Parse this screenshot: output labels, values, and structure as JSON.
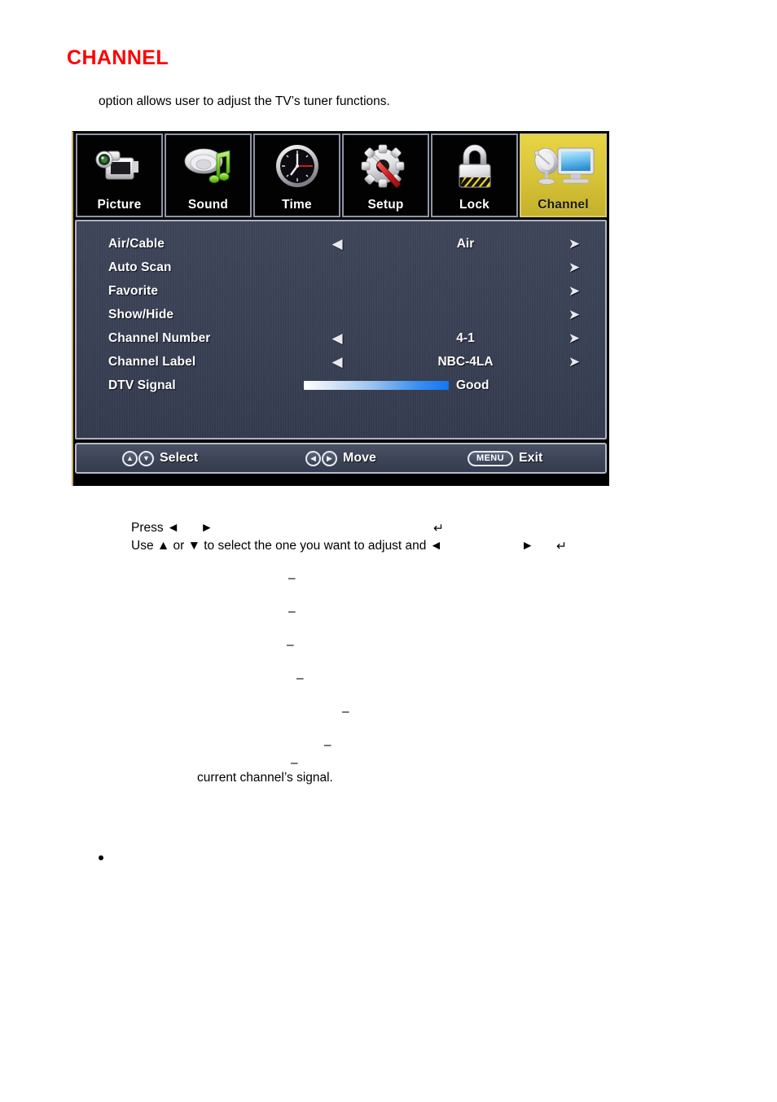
{
  "page": {
    "title": "CHANNEL",
    "title_color": "#fe0000",
    "intro": "option allows user to adjust the TV’s tuner functions."
  },
  "osd": {
    "tabs": [
      {
        "label": "Picture",
        "icon": "camcorder-icon",
        "active": false
      },
      {
        "label": "Sound",
        "icon": "speaker-music-note-icon",
        "active": false
      },
      {
        "label": "Time",
        "icon": "clock-icon",
        "active": false
      },
      {
        "label": "Setup",
        "icon": "gear-screwdriver-icon",
        "active": false
      },
      {
        "label": "Lock",
        "icon": "padlock-icon",
        "active": false
      },
      {
        "label": "Channel",
        "icon": "satellite-dish-tv-icon",
        "active": true
      }
    ],
    "active_tab_color": "#d9c63a",
    "rows": [
      {
        "label": "Air/Cable",
        "left_arrow": "◀",
        "value": "Air",
        "right_arrow": "➤",
        "type": "value"
      },
      {
        "label": "Auto Scan",
        "left_arrow": "",
        "value": "",
        "right_arrow": "➤",
        "type": "submenu"
      },
      {
        "label": "Favorite",
        "left_arrow": "",
        "value": "",
        "right_arrow": "➤",
        "type": "submenu"
      },
      {
        "label": "Show/Hide",
        "left_arrow": "",
        "value": "",
        "right_arrow": "➤",
        "type": "submenu"
      },
      {
        "label": "Channel Number",
        "left_arrow": "◀",
        "value": "4-1",
        "right_arrow": "➤",
        "type": "value"
      },
      {
        "label": "Channel Label",
        "left_arrow": "◀",
        "value": "NBC-4LA",
        "right_arrow": "➤",
        "type": "value"
      },
      {
        "label": "DTV Signal",
        "left_arrow": "",
        "value": "Good",
        "right_arrow": "",
        "type": "meter",
        "meter_percent": 100
      }
    ],
    "footer": {
      "select": {
        "keys": [
          "▲",
          "▼"
        ],
        "label": "Select"
      },
      "move": {
        "keys": [
          "◀",
          "▶"
        ],
        "label": "Move"
      },
      "exit": {
        "key": "MENU",
        "label": "Exit"
      }
    }
  },
  "instructions": {
    "press_line": "Press ◄      ►",
    "press_line_enter": "↵",
    "use_line": "Use ▲ or ▼ to select the one you want to adjust and ◄",
    "use_line_arrow2": "►",
    "use_line_enter": "↵",
    "dashes": [
      "–",
      "–",
      "–",
      "–",
      "–",
      "–",
      "–"
    ],
    "signal_line": "current channel’s signal."
  }
}
